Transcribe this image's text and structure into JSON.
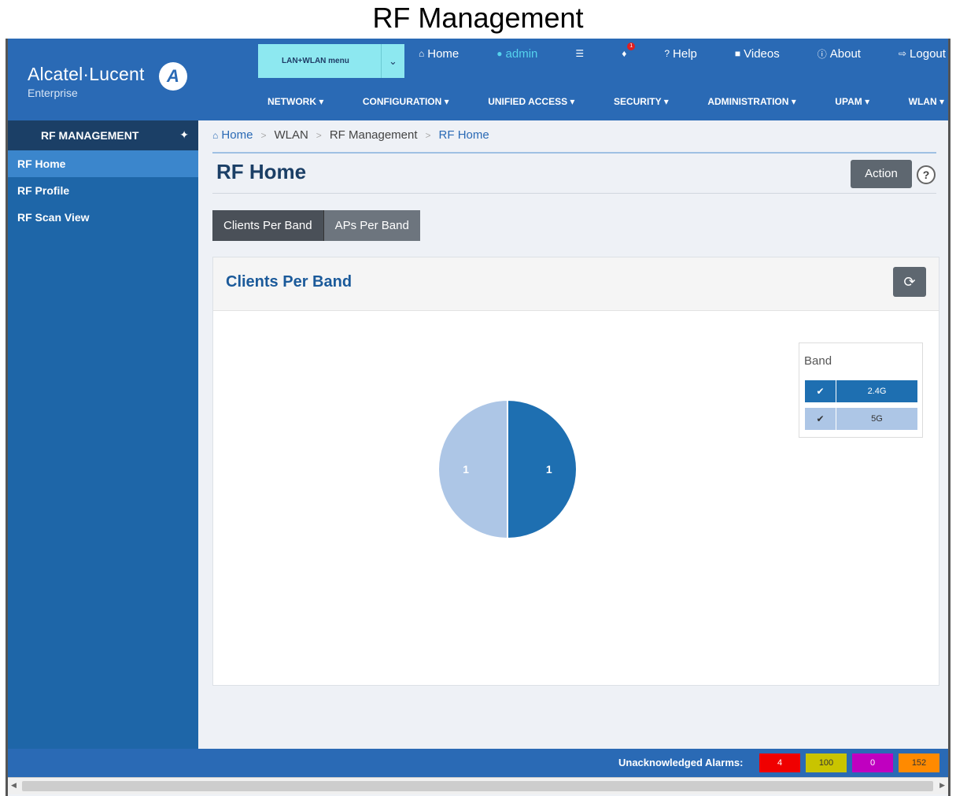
{
  "page_title": "RF Management",
  "header": {
    "brand_name": "Alcatel·Lucent",
    "brand_sub": "Enterprise",
    "menu_selector": "LAN+WLAN menu",
    "top_links": {
      "home": "Home",
      "admin": "admin",
      "help": "Help",
      "videos": "Videos",
      "about": "About",
      "logout": "Logout"
    },
    "notification_count": "1",
    "nav": [
      "NETWORK ▾",
      "CONFIGURATION ▾",
      "UNIFIED ACCESS ▾",
      "SECURITY ▾",
      "ADMINISTRATION ▾",
      "UPAM ▾",
      "WLAN ▾"
    ]
  },
  "sidebar": {
    "title": "RF MANAGEMENT",
    "items": [
      {
        "label": "RF Home",
        "active": true
      },
      {
        "label": "RF Profile",
        "active": false
      },
      {
        "label": "RF Scan View",
        "active": false
      }
    ]
  },
  "breadcrumb": [
    "Home",
    "WLAN",
    "RF Management",
    "RF Home"
  ],
  "content": {
    "title": "RF Home",
    "action_label": "Action",
    "help_label": "?",
    "tabs": [
      "Clients Per Band",
      "APs Per Band"
    ],
    "panel_title": "Clients Per Band"
  },
  "chart_data": {
    "type": "pie",
    "legend_title": "Band",
    "legend_position": "top-right",
    "series": [
      {
        "name": "2.4G",
        "value": 1,
        "color": "#1e6fb1"
      },
      {
        "name": "5G",
        "value": 1,
        "color": "#adc6e6"
      }
    ]
  },
  "footer": {
    "alarms_label": "Unacknowledged Alarms:",
    "alarms": [
      {
        "value": "4",
        "bg": "#f00000",
        "fg": "#ffffff"
      },
      {
        "value": "100",
        "bg": "#c9c400",
        "fg": "#333333"
      },
      {
        "value": "0",
        "bg": "#c000c0",
        "fg": "#ffffff"
      },
      {
        "value": "152",
        "bg": "#ff8a00",
        "fg": "#333333"
      }
    ]
  },
  "icons": [
    "home-icon",
    "user-icon",
    "list-icon",
    "bell-icon",
    "question-icon",
    "video-icon",
    "info-icon",
    "logout-icon",
    "pin-icon",
    "refresh-icon",
    "check-icon"
  ]
}
